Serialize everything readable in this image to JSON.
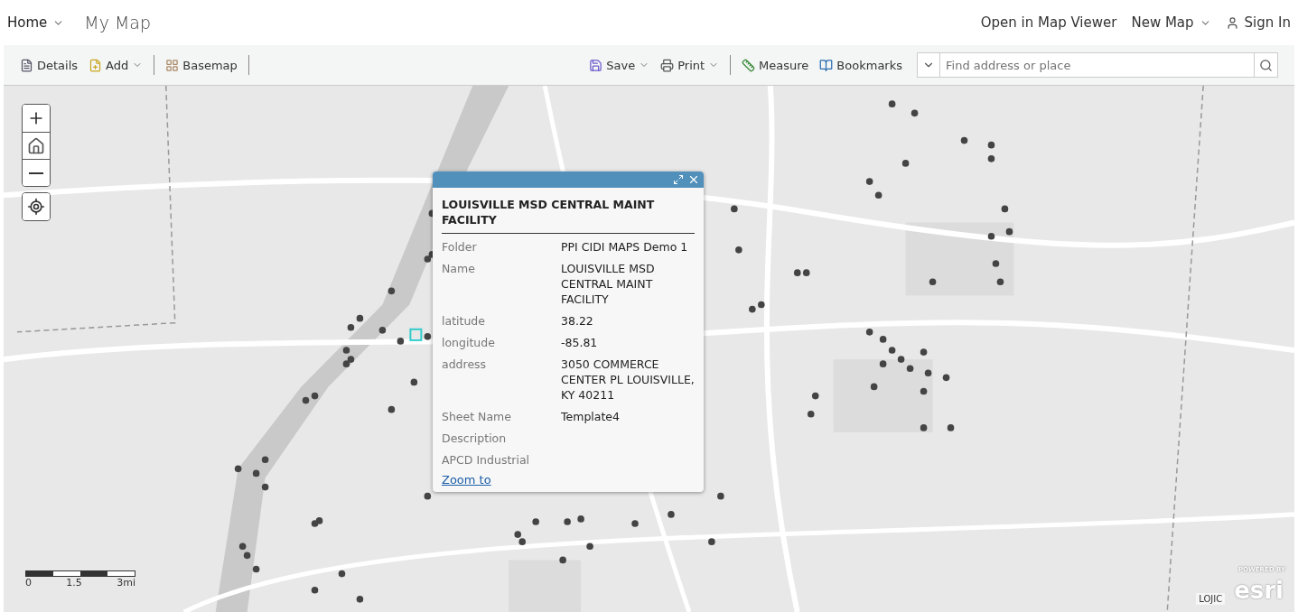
{
  "header": {
    "home_menu": "Home",
    "title": "My Map",
    "links": [
      {
        "label": "Open in Map Viewer",
        "kind": "link"
      },
      {
        "label": "New Map",
        "kind": "dropdown"
      },
      {
        "label": "Sign In",
        "kind": "user"
      }
    ]
  },
  "toolbar": {
    "left": [
      {
        "label": "Details",
        "dropdown": false
      },
      {
        "label": "Add",
        "dropdown": true
      },
      {
        "label": "Basemap",
        "dropdown": false
      }
    ],
    "right": [
      {
        "label": "Save",
        "dropdown": true
      },
      {
        "label": "Print",
        "dropdown": true
      },
      {
        "label": "Measure",
        "dropdown": false
      },
      {
        "label": "Bookmarks",
        "dropdown": false
      }
    ],
    "search": {
      "placeholder": "Find address or place"
    }
  },
  "map": {
    "kind": "picture",
    "popup": {
      "title": "LOUISVILLE MSD CENTRAL MAINT FACILITY",
      "fields": [
        {
          "label": "Folder",
          "value": "PPI CIDI MAPS Demo 1"
        },
        {
          "label": "Name",
          "value": "LOUISVILLE MSD CENTRAL MAINT FACILITY"
        },
        {
          "label": "latitude",
          "value": "38.22"
        },
        {
          "label": "longitude",
          "value": "-85.81"
        },
        {
          "label": "address",
          "value": "3050 COMMERCE CENTER PL LOUISVILLE, KY 40211"
        },
        {
          "label": "Sheet Name",
          "value": "Template4"
        },
        {
          "label": "Description"
        },
        {
          "label": "APCD Industrial"
        }
      ],
      "link": "Zoom to"
    },
    "scale": [
      "0",
      "1.5",
      "3mi"
    ],
    "attribution": "LOJIC",
    "powered_by": "POWERED BY",
    "logo": "esri"
  }
}
